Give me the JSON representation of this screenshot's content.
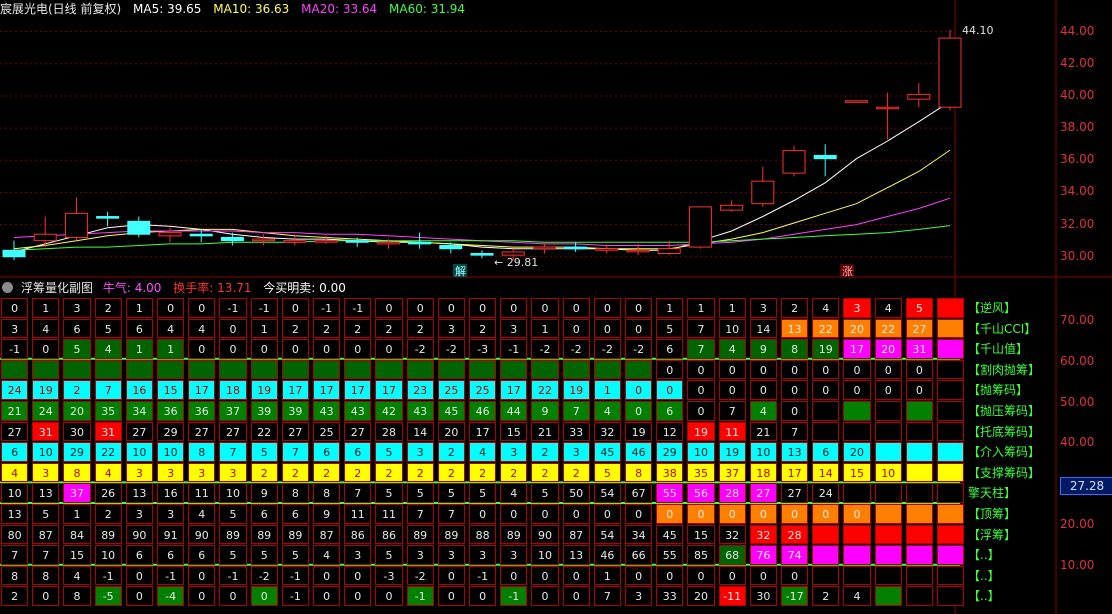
{
  "main_header": {
    "title": "宸展光电(日线 前复权)",
    "ma": [
      {
        "label": "MA5: 39.65",
        "color": "#ffffff"
      },
      {
        "label": "MA10: 36.63",
        "color": "#ffff50"
      },
      {
        "label": "MA20: 33.64",
        "color": "#ff40ff"
      },
      {
        "label": "MA60: 31.94",
        "color": "#40ff40"
      }
    ]
  },
  "price_axis": [
    "44.00",
    "42.00",
    "40.00",
    "38.00",
    "36.00",
    "34.00",
    "32.00",
    "30.00"
  ],
  "price_axis_range": [
    29.3,
    44.6
  ],
  "high_label": "44.10",
  "low_label": "29.81",
  "markers": {
    "jie": "解",
    "zhang": "涨"
  },
  "candles": [
    {
      "o": 30.4,
      "c": 30.0,
      "h": 31.0,
      "l": 29.8
    },
    {
      "o": 31.0,
      "c": 31.4,
      "h": 32.5,
      "l": 30.6
    },
    {
      "o": 31.2,
      "c": 32.7,
      "h": 33.7,
      "l": 31.0
    },
    {
      "o": 32.5,
      "c": 32.4,
      "h": 32.8,
      "l": 31.9
    },
    {
      "o": 32.2,
      "c": 31.4,
      "h": 32.5,
      "l": 31.2
    },
    {
      "o": 31.3,
      "c": 31.5,
      "h": 31.8,
      "l": 30.9
    },
    {
      "o": 31.4,
      "c": 31.3,
      "h": 31.7,
      "l": 30.9
    },
    {
      "o": 31.2,
      "c": 31.0,
      "h": 31.5,
      "l": 30.7
    },
    {
      "o": 31.0,
      "c": 31.1,
      "h": 31.4,
      "l": 30.7
    },
    {
      "o": 30.9,
      "c": 31.0,
      "h": 31.3,
      "l": 30.7
    },
    {
      "o": 31.0,
      "c": 31.0,
      "h": 31.3,
      "l": 30.8
    },
    {
      "o": 31.0,
      "c": 30.9,
      "h": 31.2,
      "l": 30.6
    },
    {
      "o": 30.8,
      "c": 30.9,
      "h": 31.1,
      "l": 30.5
    },
    {
      "o": 30.9,
      "c": 30.8,
      "h": 31.5,
      "l": 30.5
    },
    {
      "o": 30.7,
      "c": 30.5,
      "h": 30.9,
      "l": 30.2
    },
    {
      "o": 30.2,
      "c": 30.1,
      "h": 30.4,
      "l": 29.9
    },
    {
      "o": 30.1,
      "c": 30.3,
      "h": 30.5,
      "l": 29.8
    },
    {
      "o": 30.5,
      "c": 30.6,
      "h": 30.8,
      "l": 30.2
    },
    {
      "o": 30.6,
      "c": 30.5,
      "h": 30.9,
      "l": 30.3
    },
    {
      "o": 30.5,
      "c": 30.5,
      "h": 30.7,
      "l": 30.2
    },
    {
      "o": 30.4,
      "c": 30.4,
      "h": 30.8,
      "l": 30.1
    },
    {
      "o": 30.2,
      "c": 30.5,
      "h": 31.0,
      "l": 30.1
    },
    {
      "o": 30.6,
      "c": 33.1,
      "h": 33.1,
      "l": 30.5
    },
    {
      "o": 32.9,
      "c": 33.2,
      "h": 33.5,
      "l": 32.8
    },
    {
      "o": 33.3,
      "c": 34.7,
      "h": 35.6,
      "l": 33.1
    },
    {
      "o": 35.2,
      "c": 36.6,
      "h": 36.9,
      "l": 35.0
    },
    {
      "o": 36.3,
      "c": 36.1,
      "h": 37.0,
      "l": 35.0
    },
    {
      "o": 39.7,
      "c": 39.7,
      "h": 39.7,
      "l": 39.7
    },
    {
      "o": 39.3,
      "c": 39.3,
      "h": 40.2,
      "l": 37.3
    },
    {
      "o": 39.8,
      "c": 40.1,
      "h": 40.8,
      "l": 39.3
    },
    {
      "o": 39.3,
      "c": 43.6,
      "h": 44.1,
      "l": 39.1
    }
  ],
  "ma_series": {
    "ma5": [
      30.3,
      30.8,
      31.3,
      31.8,
      32.0,
      31.9,
      31.7,
      31.4,
      31.2,
      31.1,
      31.1,
      31.0,
      30.9,
      30.9,
      30.8,
      30.6,
      30.5,
      30.5,
      30.5,
      30.5,
      30.4,
      30.4,
      31.0,
      31.6,
      32.5,
      33.5,
      34.6,
      36.1,
      37.2,
      38.4,
      39.65
    ],
    "ma10": [
      30.5,
      30.7,
      31.0,
      31.3,
      31.5,
      31.6,
      31.7,
      31.7,
      31.5,
      31.3,
      31.2,
      31.1,
      31.0,
      30.9,
      30.8,
      30.7,
      30.6,
      30.6,
      30.6,
      30.5,
      30.5,
      30.5,
      30.8,
      31.1,
      31.5,
      32.1,
      32.7,
      33.3,
      34.3,
      35.3,
      36.63
    ],
    "ma20": [
      31.2,
      31.3,
      31.4,
      31.5,
      31.6,
      31.6,
      31.6,
      31.6,
      31.5,
      31.5,
      31.4,
      31.4,
      31.3,
      31.2,
      31.1,
      31.0,
      30.9,
      30.8,
      30.8,
      30.7,
      30.7,
      30.7,
      30.8,
      30.9,
      31.1,
      31.4,
      31.7,
      32.0,
      32.5,
      33.0,
      33.64
    ],
    "ma60": [
      30.4,
      30.5,
      30.6,
      30.6,
      30.7,
      30.8,
      30.8,
      30.9,
      30.9,
      30.9,
      31.0,
      31.0,
      31.0,
      31.0,
      31.0,
      31.0,
      31.0,
      30.9,
      30.9,
      30.9,
      30.9,
      30.9,
      30.9,
      31.0,
      31.1,
      31.2,
      31.3,
      31.4,
      31.5,
      31.7,
      31.94
    ]
  },
  "sub_header": {
    "title": "浮筹量化副图",
    "items": [
      {
        "label": "牛气: 4.00",
        "color": "#ff50ff"
      },
      {
        "label": "换手率: 13.71",
        "color": "#ff3030"
      },
      {
        "label": "今买明卖: 0.00",
        "color": "#ffffff"
      }
    ]
  },
  "sub_axis": [
    "70.00",
    "60.00",
    "50.00",
    "40.00",
    "30.00",
    "20.00",
    "10.00"
  ],
  "sub_axis_highlight": "27.28",
  "row_labels": [
    "【逆风】",
    "【千山CCI】",
    "【千山值】",
    "【割肉抛筹】",
    "【抛筹码】",
    "【抛压筹码】",
    "【托底筹码】",
    "【介入筹码】",
    "【支撑筹码】",
    "擎天柱】",
    "【顶筹】",
    "【浮筹】",
    "【..】",
    "【..】",
    "【..】"
  ],
  "palette": {
    "N": "#000000",
    "R": "#ff0000",
    "O": "#ff8000",
    "Y": "#ffff00",
    "C": "#00ffff",
    "G": "#008000",
    "K": "#006400",
    "M": "#ff00ff",
    "L": "#00ff00",
    "D": "#ff0000",
    "E": "#000000",
    "B": "#008000",
    "X": "#005000",
    "P": "#ff00ff",
    "Q": "#ff00ff"
  },
  "grid_rows": [
    {
      "bg": "NNNNNNNNNNNNNNNNNNNNNNNNNNNRNRR",
      "v": [
        "0",
        "1",
        "3",
        "2",
        "1",
        "0",
        "0",
        "-1",
        "-1",
        "0",
        "-1",
        "-1",
        "0",
        "0",
        "0",
        "0",
        "0",
        "0",
        "0",
        "0",
        "0",
        "1",
        "1",
        "1",
        "3",
        "2",
        "4",
        "3",
        "4",
        "5"
      ]
    },
    {
      "bg": "NNNNNNNNNNNNNNNNNNNNNNNNNOOOOOO",
      "v": [
        "3",
        "4",
        "6",
        "5",
        "6",
        "4",
        "4",
        "0",
        "1",
        "2",
        "2",
        "2",
        "2",
        "2",
        "3",
        "2",
        "3",
        "1",
        "0",
        "0",
        "0",
        "5",
        "7",
        "10",
        "14",
        "13",
        "22",
        "20",
        "22",
        "27"
      ]
    },
    {
      "bg": "NNKKKKNNNNNNNNNNNNNNNNKKKKKMMMM",
      "v": [
        "-1",
        "0",
        "5",
        "4",
        "1",
        "1",
        "0",
        "0",
        "0",
        "0",
        "0",
        "0",
        "0",
        "-2",
        "-2",
        "-3",
        "-1",
        "-2",
        "-2",
        "-2",
        "-2",
        "6",
        "7",
        "4",
        "9",
        "8",
        "19",
        "17",
        "20",
        "31"
      ]
    },
    {
      "bg": "KKKKKKKKKKKKKKKKKKKKKNNNNNNNNNN",
      "v": [
        "",
        "",
        "",
        "",
        "",
        "",
        "",
        "",
        "",
        "",
        "",
        "",
        "",
        "",
        "",
        "",
        "",
        "",
        "",
        "",
        "",
        "0",
        "0",
        "0",
        "0",
        "0",
        "0",
        "0",
        "0",
        "0"
      ]
    },
    {
      "bg": "CCCCCCCCCCCCCCCCCCCCCCNNNNNNNNN",
      "v": [
        "24",
        "19",
        "2",
        "7",
        "16",
        "15",
        "17",
        "18",
        "19",
        "17",
        "17",
        "17",
        "17",
        "23",
        "25",
        "25",
        "17",
        "22",
        "19",
        "1",
        "0",
        "0",
        "0",
        "0",
        "0",
        "0",
        "0",
        "0",
        "0",
        "0"
      ]
    },
    {
      "bg": "GGGGGGGGGGGGGGGGGGGGGGNNGNNGNGN",
      "v": [
        "21",
        "24",
        "20",
        "35",
        "34",
        "36",
        "36",
        "37",
        "39",
        "39",
        "43",
        "43",
        "42",
        "43",
        "45",
        "46",
        "44",
        "9",
        "7",
        "4",
        "0",
        "6",
        "0",
        "7",
        "4",
        "0"
      ]
    },
    {
      "bg": "NRNRNNNNNNNNNNNNNNNNNNRRNNNNNNN",
      "v": [
        "27",
        "31",
        "30",
        "31",
        "27",
        "29",
        "27",
        "27",
        "22",
        "27",
        "25",
        "27",
        "28",
        "14",
        "20",
        "17",
        "15",
        "21",
        "33",
        "32",
        "19",
        "12",
        "19",
        "11",
        "21",
        "7"
      ]
    },
    {
      "bg": "CCCCCCCCCCCCCCCCCCCCCCCCCCCCCCC",
      "v": [
        "6",
        "10",
        "29",
        "22",
        "10",
        "10",
        "8",
        "7",
        "5",
        "7",
        "6",
        "6",
        "5",
        "3",
        "2",
        "4",
        "3",
        "2",
        "3",
        "45",
        "46",
        "29",
        "10",
        "19",
        "10",
        "13",
        "6",
        "20"
      ]
    },
    {
      "bg": "YYYYYYYYYYYYYYYYYYYYYYYYYYYYYYY",
      "v": [
        "4",
        "3",
        "8",
        "4",
        "3",
        "3",
        "3",
        "3",
        "2",
        "2",
        "2",
        "2",
        "2",
        "2",
        "2",
        "2",
        "2",
        "2",
        "2",
        "5",
        "8",
        "38",
        "35",
        "37",
        "18",
        "17",
        "14",
        "15",
        "10"
      ]
    },
    {
      "bg": "NNMNNNNNNNNNNNNNNNNNNMMMMNNNNNN",
      "v": [
        "10",
        "13",
        "37",
        "26",
        "13",
        "16",
        "11",
        "10",
        "9",
        "8",
        "8",
        "7",
        "5",
        "5",
        "5",
        "5",
        "4",
        "5",
        "50",
        "54",
        "67",
        "55",
        "56",
        "28",
        "27",
        "27",
        "24"
      ]
    },
    {
      "bg": "NNNNNNNNNNNNNNNNNNNNNOOOOOOOOOO",
      "v": [
        "13",
        "5",
        "1",
        "2",
        "3",
        "3",
        "4",
        "5",
        "6",
        "6",
        "9",
        "11",
        "11",
        "7",
        "7",
        "0",
        "0",
        "0",
        "0",
        "0",
        "0",
        "0",
        "0",
        "0",
        "0",
        "0",
        "0",
        "0"
      ]
    },
    {
      "bg": "NNNNNNNNNNNNNNNNNNNNNNNNRRRRRRR",
      "v": [
        "80",
        "87",
        "84",
        "89",
        "90",
        "91",
        "90",
        "89",
        "89",
        "89",
        "87",
        "86",
        "86",
        "89",
        "89",
        "88",
        "89",
        "90",
        "87",
        "54",
        "34",
        "45",
        "15",
        "32",
        "32",
        "28"
      ]
    },
    {
      "bg": "NNNNNNNNNNNNNNNNNNNNNNNKMMMMMMM",
      "v": [
        "7",
        "7",
        "15",
        "10",
        "6",
        "6",
        "6",
        "5",
        "5",
        "5",
        "4",
        "3",
        "5",
        "3",
        "3",
        "3",
        "3",
        "10",
        "13",
        "46",
        "66",
        "55",
        "85",
        "68",
        "76",
        "74"
      ]
    },
    {
      "bg": "NNNNNNNNNNNNNNNNNNNNNNNNNNNNNNN",
      "v": [
        "8",
        "8",
        "4",
        "-1",
        "0",
        "-1",
        "0",
        "-1",
        "-2",
        "-1",
        "0",
        "0",
        "-3",
        "-2",
        "0",
        "-1",
        "0",
        "0",
        "0",
        "1",
        "0",
        "0",
        "0",
        "0",
        "0",
        "0"
      ]
    },
    {
      "bg": "NNNGNGNNGNNNNGNNGNNNNNNRNGNNGNN",
      "v": [
        "2",
        "0",
        "8",
        "-5",
        "0",
        "-4",
        "0",
        "0",
        "0",
        "-1",
        "0",
        "0",
        "0",
        "-1",
        "0",
        "0",
        "-1",
        "0",
        "0",
        "7",
        "3",
        "33",
        "20",
        "-11",
        "30",
        "-17",
        "2",
        "4"
      ]
    }
  ]
}
